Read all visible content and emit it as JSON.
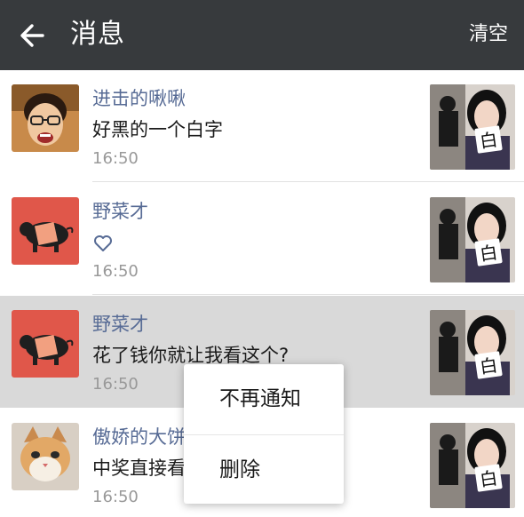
{
  "header": {
    "title": "消息",
    "back_icon": "arrow-left-icon",
    "clear_label": "清空"
  },
  "messages": [
    {
      "name": "进击的啾啾",
      "text": "好黑的一个白字",
      "time": "16:50",
      "avatar": "person-with-glasses-avatar",
      "thumbnail_text": "白"
    },
    {
      "name": "野菜才",
      "text": "",
      "icon": "heart-icon",
      "time": "16:50",
      "avatar": "red-pig-avatar",
      "thumbnail_text": "白"
    },
    {
      "name": "野菜才",
      "text": "花了钱你就让我看这个?",
      "time": "16:50",
      "avatar": "red-pig-avatar",
      "thumbnail_text": "白"
    },
    {
      "name": "傲娇的大饼",
      "text": "中奖直接看",
      "time": "16:50",
      "avatar": "cat-avatar",
      "thumbnail_text": "白"
    }
  ],
  "context_menu": {
    "items": [
      "不再通知",
      "删除"
    ]
  },
  "colors": {
    "header_bg": "#373a3d",
    "name_color": "#576b95",
    "time_color": "#999999",
    "pressed_row_bg": "#d9d9d9"
  }
}
